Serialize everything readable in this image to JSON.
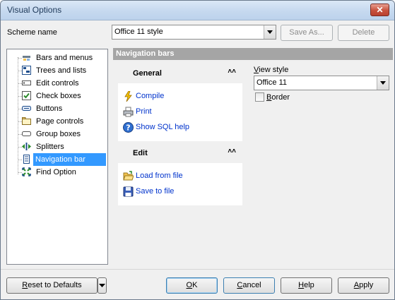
{
  "window": {
    "title": "Visual Options",
    "close_glyph": "✕"
  },
  "scheme": {
    "label": "Scheme name",
    "value": "Office 11 style",
    "save_as": "Save As...",
    "delete": "Delete"
  },
  "tree": {
    "items": [
      {
        "label": "Bars and menus",
        "icon": "bars-menus-icon"
      },
      {
        "label": "Trees and lists",
        "icon": "tree-list-icon"
      },
      {
        "label": "Edit controls",
        "icon": "edit-control-icon"
      },
      {
        "label": "Check boxes",
        "icon": "checkbox-icon"
      },
      {
        "label": "Buttons",
        "icon": "button-icon"
      },
      {
        "label": "Page controls",
        "icon": "page-control-icon"
      },
      {
        "label": "Group boxes",
        "icon": "group-box-icon"
      },
      {
        "label": "Splitters",
        "icon": "splitter-icon"
      },
      {
        "label": "Navigation bar",
        "icon": "navigation-bar-icon",
        "selected": true
      },
      {
        "label": "Find Option",
        "icon": "find-option-icon"
      }
    ]
  },
  "section": {
    "title": "Navigation bars"
  },
  "navbar": {
    "groups": [
      {
        "title": "General",
        "items": [
          {
            "label": "Compile",
            "icon": "lightning-icon"
          },
          {
            "label": "Print",
            "icon": "printer-icon"
          },
          {
            "label": "Show SQL help",
            "icon": "help-icon"
          }
        ]
      },
      {
        "title": "Edit",
        "items": [
          {
            "label": "Load from file",
            "icon": "open-folder-icon"
          },
          {
            "label": "Save to file",
            "icon": "floppy-disk-icon"
          }
        ]
      }
    ],
    "collapse_glyph": "˄˄"
  },
  "view_style": {
    "label_prefix": "V",
    "label_rest": "iew style",
    "value": "Office 11"
  },
  "border": {
    "label_prefix": "B",
    "label_rest": "order",
    "checked": false
  },
  "buttons": {
    "reset_prefix": "R",
    "reset_rest": "eset to Defaults",
    "ok_prefix": "O",
    "ok_rest": "K",
    "cancel_prefix": "C",
    "cancel_rest": "ancel",
    "help_prefix": "H",
    "help_rest": "elp",
    "apply_prefix": "A",
    "apply_rest": "pply"
  },
  "colors": {
    "selection": "#3399ff",
    "link": "#0033cc",
    "header_band": "#a5a5a5"
  }
}
